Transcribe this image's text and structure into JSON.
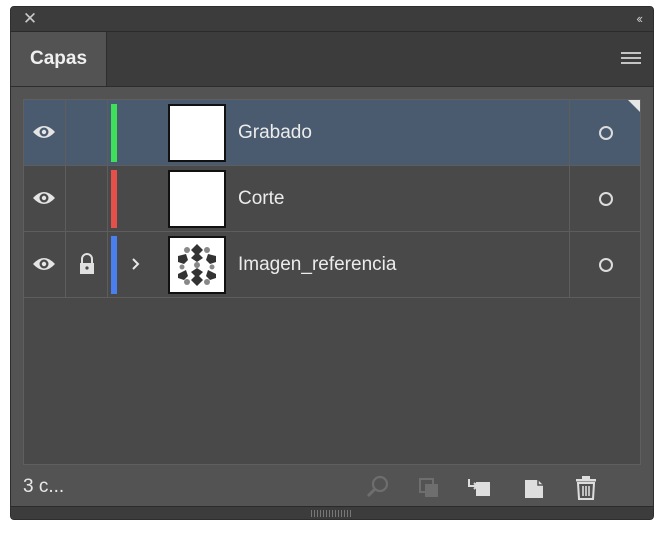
{
  "window": {
    "close_icon": "close-icon",
    "collapse_icon": "double-chevron-left-icon"
  },
  "tab": {
    "label": "Capas"
  },
  "menu_icon": "hamburger-menu-icon",
  "layers": [
    {
      "name": "Grabado",
      "color": "#3ee05a",
      "visible": true,
      "locked": false,
      "expandable": false,
      "selected": true,
      "thumbnail": "blank"
    },
    {
      "name": "Corte",
      "color": "#e6504a",
      "visible": true,
      "locked": false,
      "expandable": false,
      "selected": false,
      "thumbnail": "blank"
    },
    {
      "name": "Imagen_referencia",
      "color": "#4a7ff0",
      "visible": true,
      "locked": true,
      "expandable": true,
      "selected": false,
      "thumbnail": "pattern"
    }
  ],
  "footer": {
    "count_label": "3 c...",
    "buttons": [
      "search-icon",
      "collect-for-export-icon",
      "make-clipping-mask-icon",
      "new-layer-icon",
      "trash-icon"
    ]
  },
  "colors": {
    "selected_row": "#4a5a6f",
    "panel_bg": "#535353",
    "list_bg": "#494949"
  }
}
